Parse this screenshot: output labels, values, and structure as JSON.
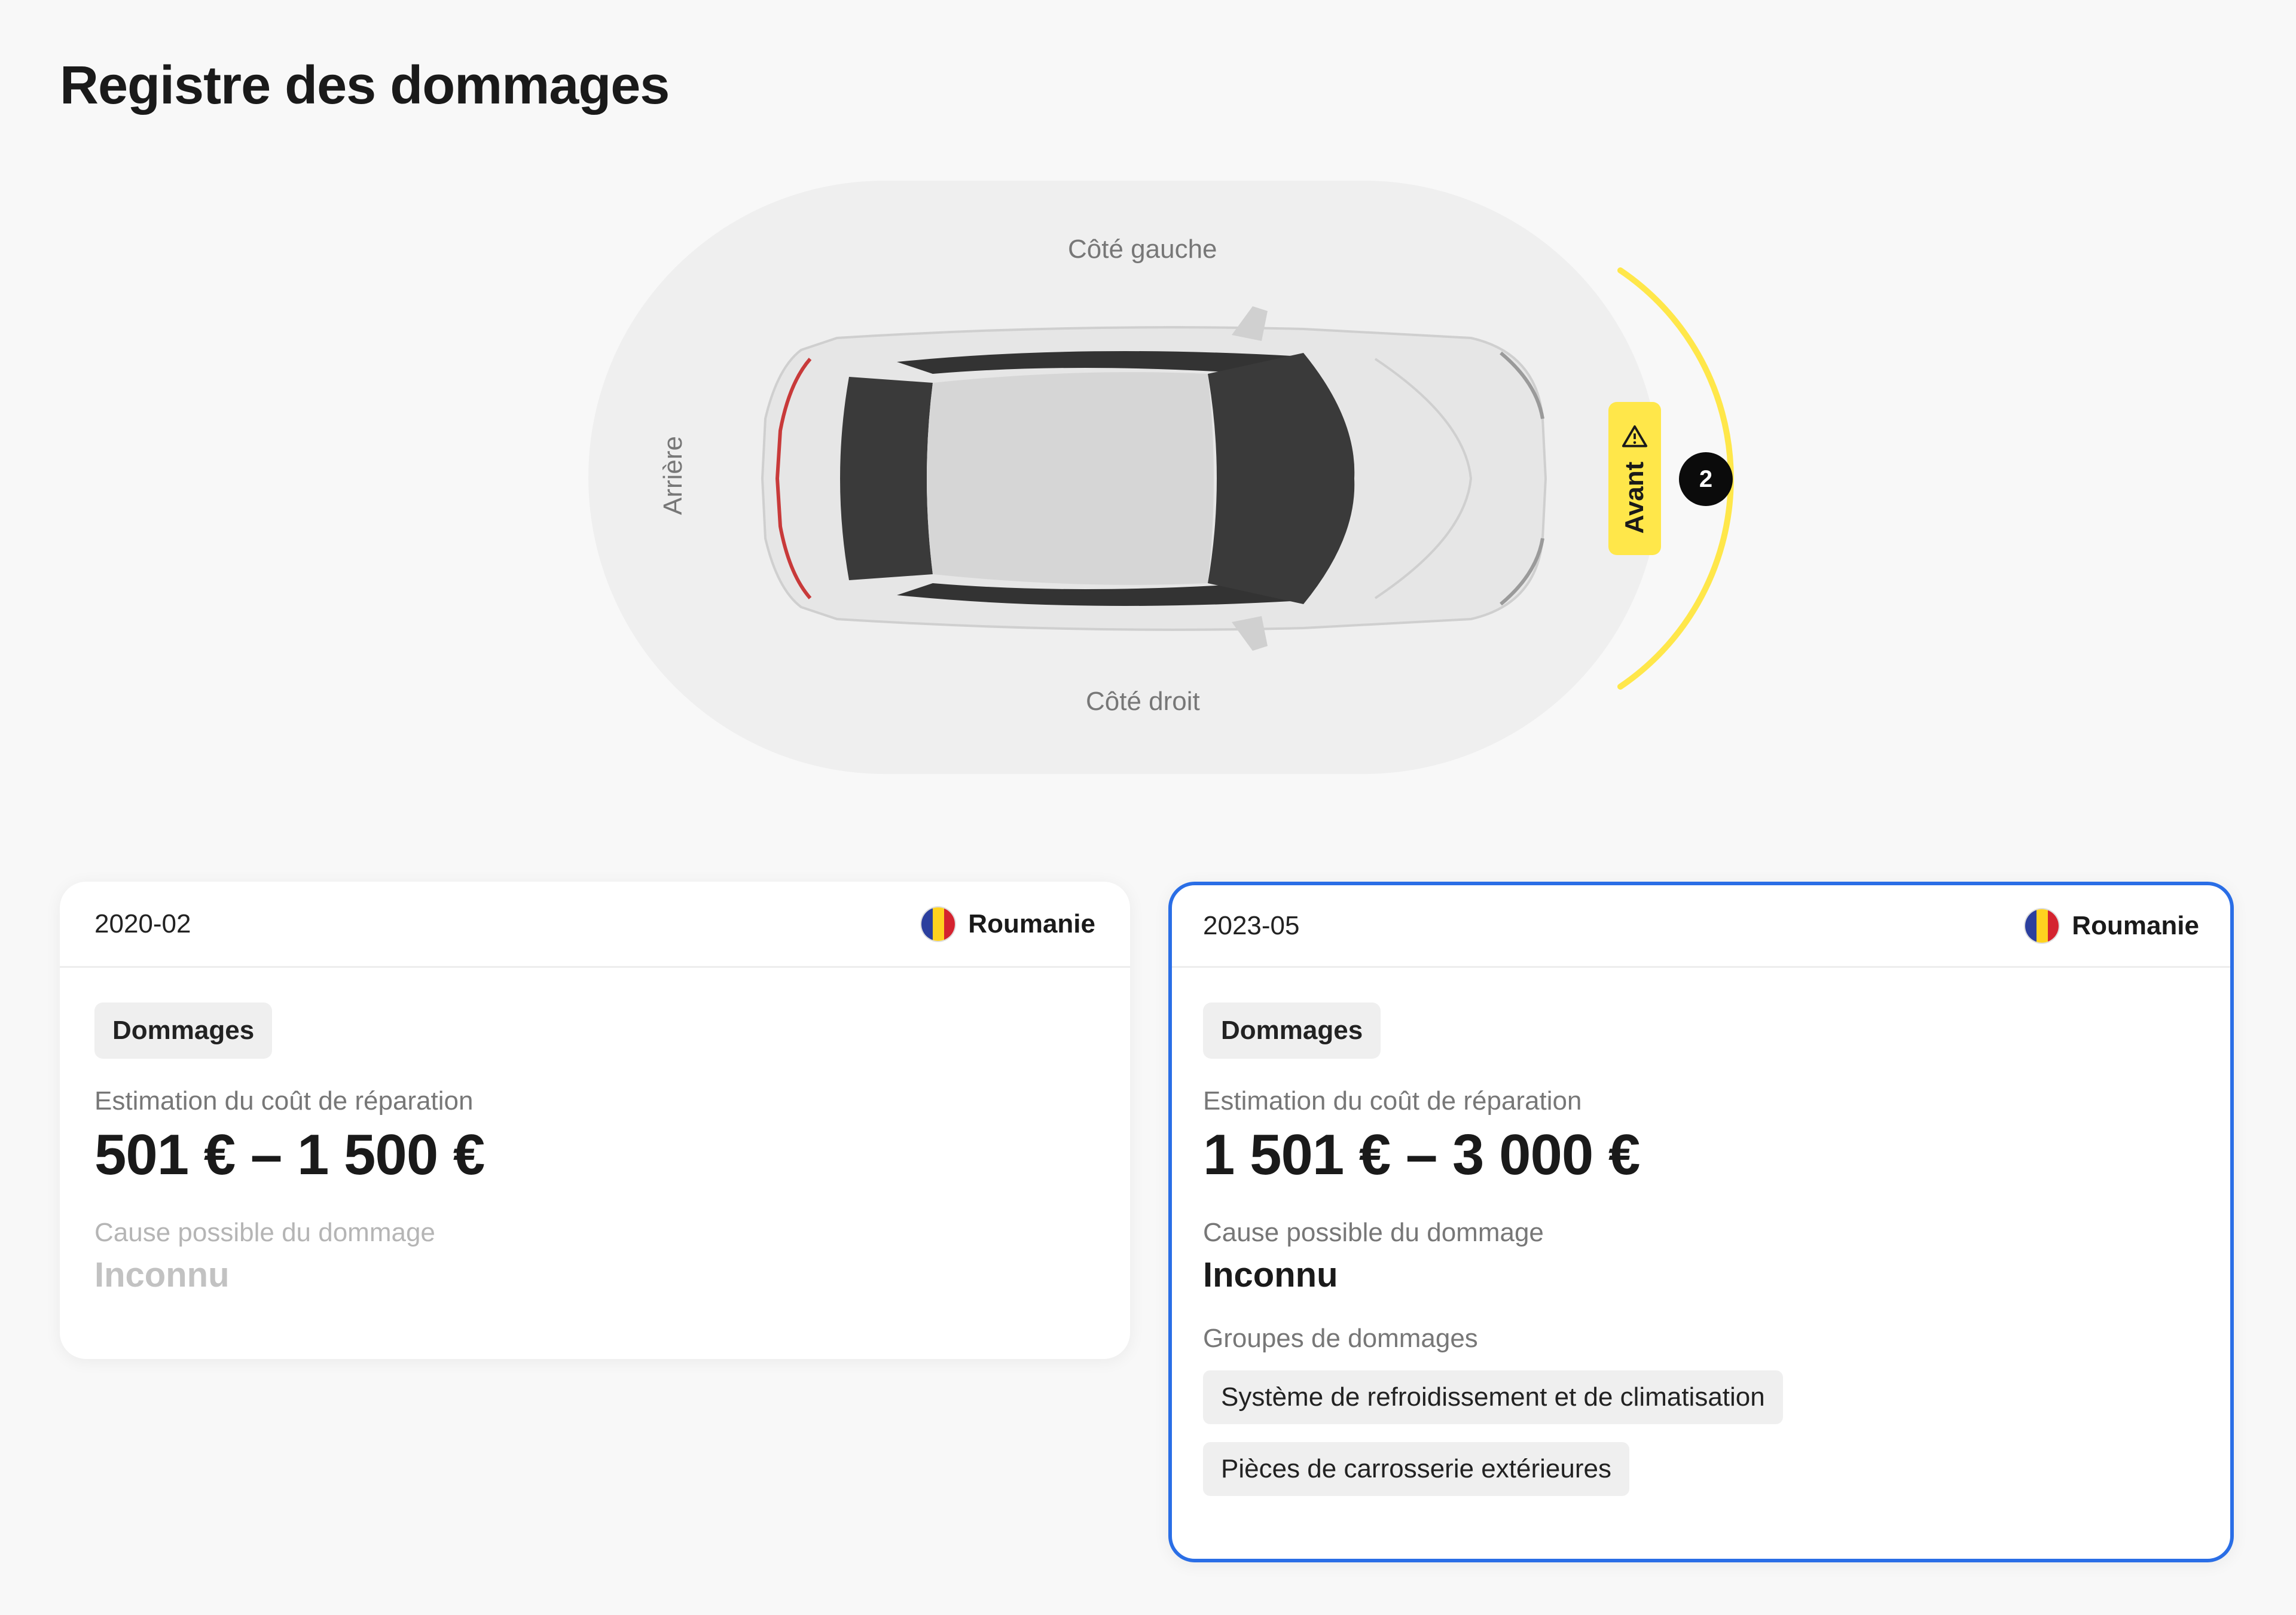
{
  "page": {
    "title": "Registre des dommages"
  },
  "diagram": {
    "left_side": "Côté gauche",
    "right_side": "Côté droit",
    "rear": "Arrière",
    "front": "Avant",
    "front_count": "2",
    "highlight_color": "#ffe74a",
    "icons": {
      "warning": "warning-triangle-icon"
    }
  },
  "records": [
    {
      "date": "2020-02",
      "country": "Roumanie",
      "type": "Dommages",
      "cost_label": "Estimation du coût de réparation",
      "cost": "501 € – 1 500 €",
      "cause_label": "Cause possible du dommage",
      "cause": "Inconnu"
    },
    {
      "date": "2023-05",
      "country": "Roumanie",
      "type": "Dommages",
      "cost_label": "Estimation du coût de réparation",
      "cost": "1 501 € – 3 000 €",
      "cause_label": "Cause possible du dommage",
      "cause": "Inconnu",
      "groups_label": "Groupes de dommages",
      "groups": [
        "Système de refroidissement et de climatisation",
        "Pièces de carrosserie extérieures"
      ],
      "selected": true,
      "selected_color": "#2a6ee6"
    }
  ]
}
